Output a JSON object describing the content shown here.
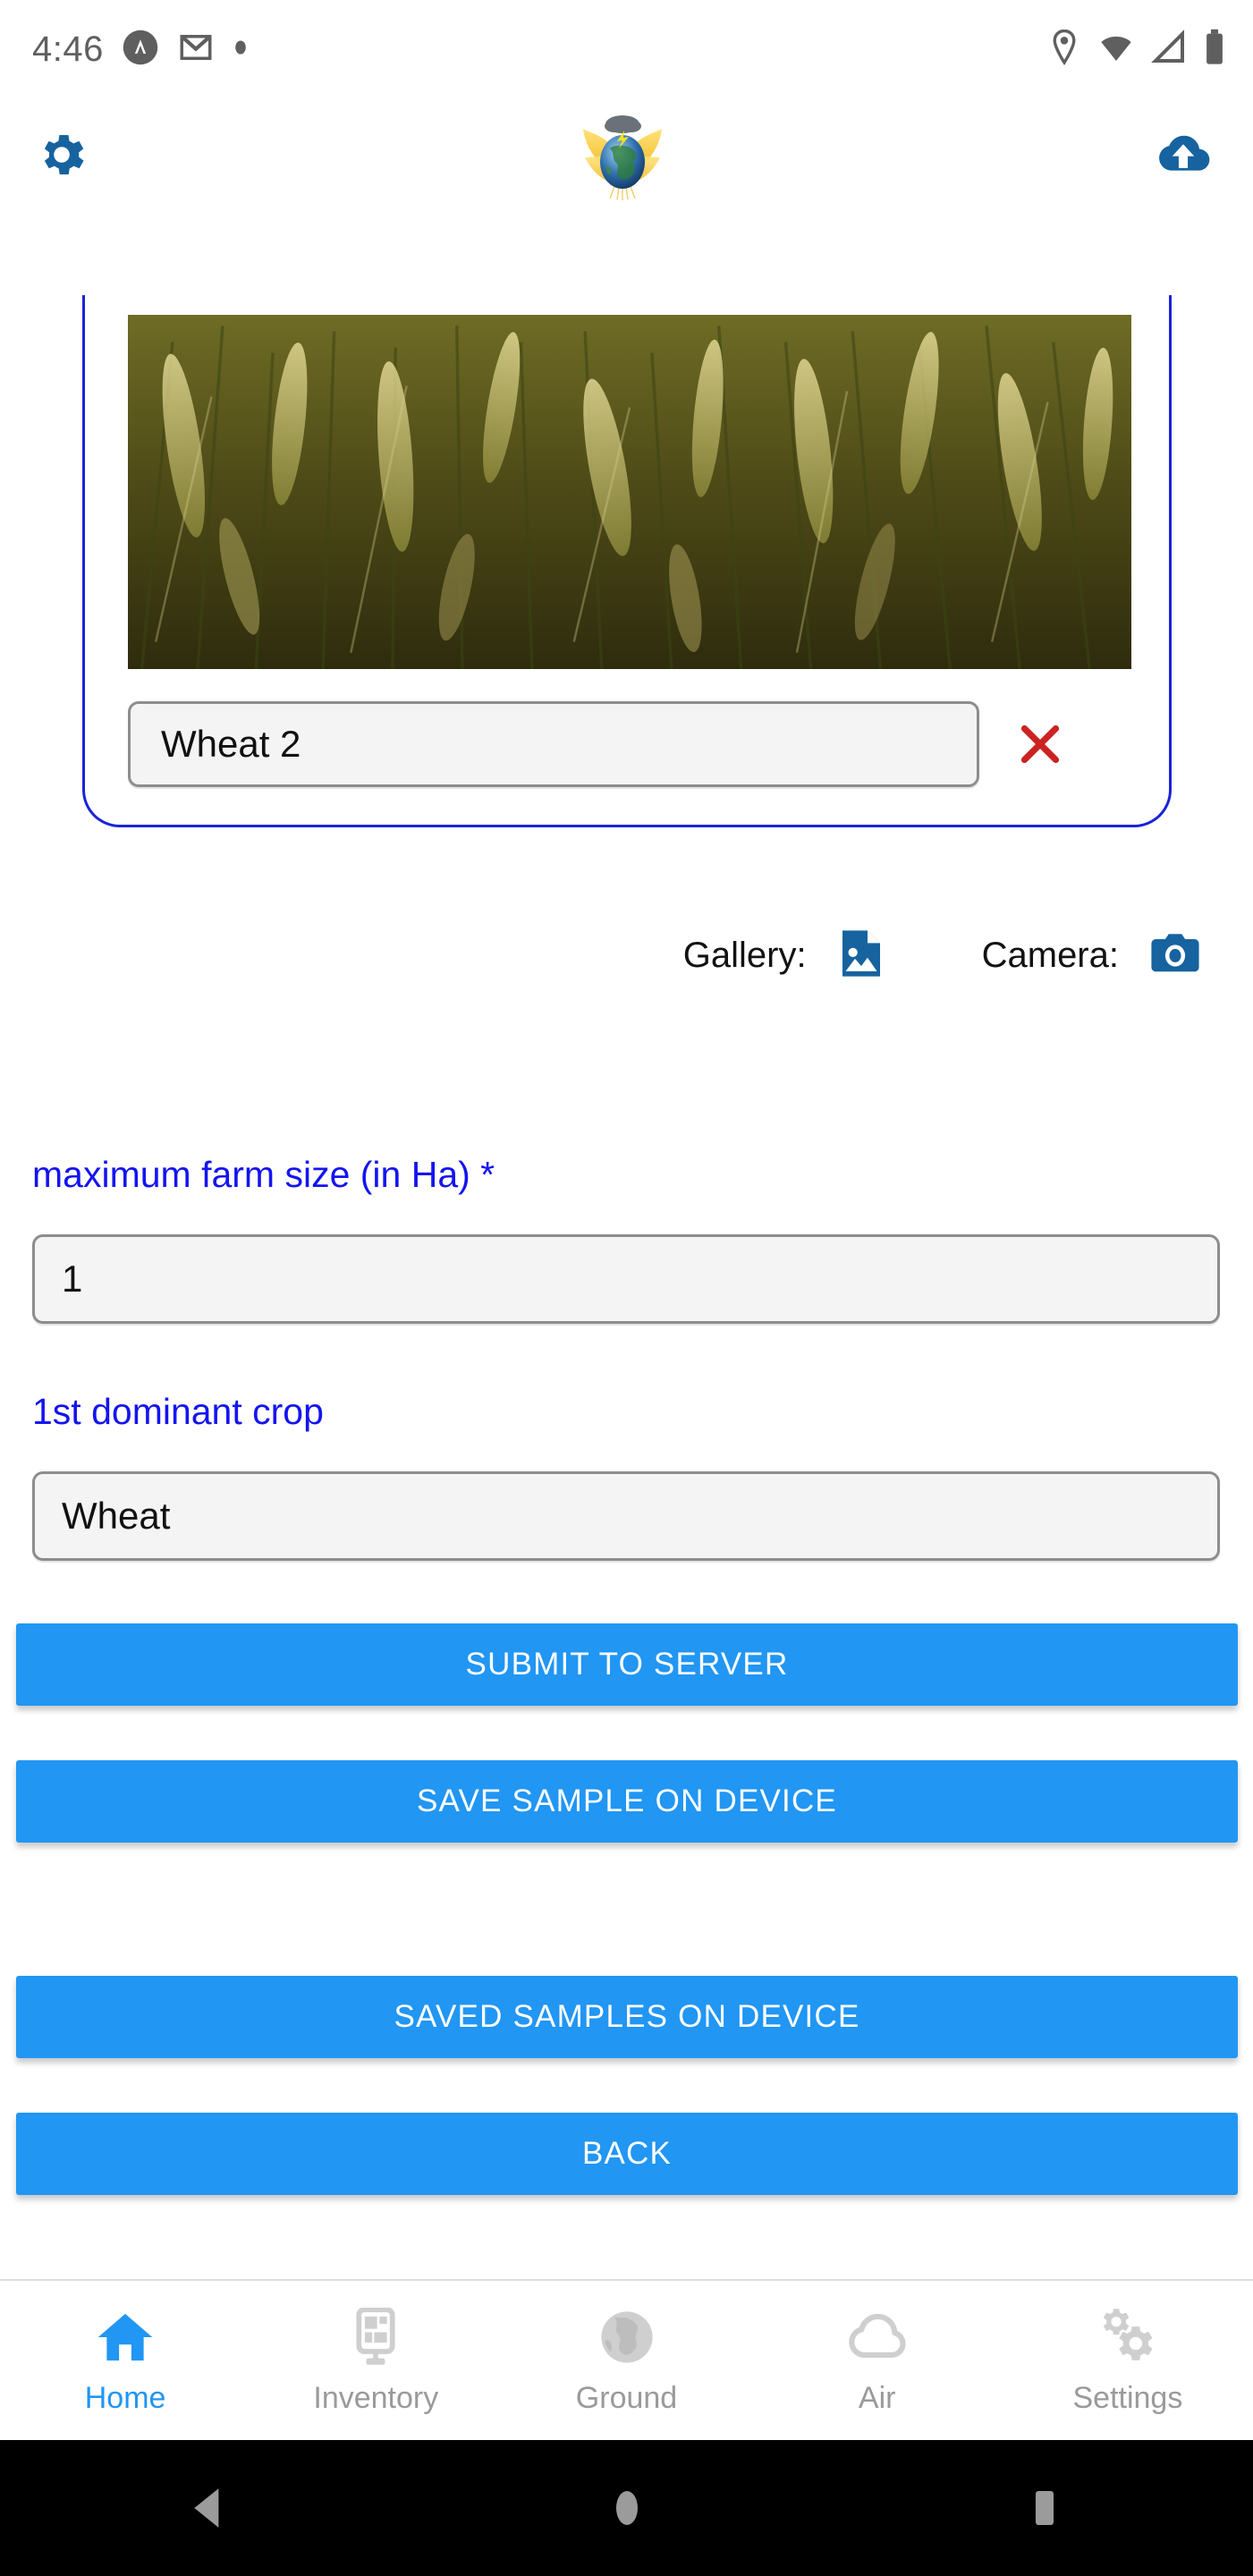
{
  "status_bar": {
    "time": "4:46",
    "left_icons": [
      "assistant-circle-icon",
      "gmail-icon",
      "dot-indicator-icon"
    ],
    "right_icons": [
      "location-icon",
      "wifi-icon",
      "cellular-signal-icon",
      "battery-icon"
    ]
  },
  "app_bar": {
    "settings_icon": "gear-icon",
    "logo": "globe-wheat-logo",
    "upload_icon": "cloud-upload-icon"
  },
  "sample_card": {
    "photo_alt": "wheat-field-photo",
    "name_value": "Wheat 2",
    "name_placeholder": "Wheat 2",
    "delete_icon": "close-x-icon"
  },
  "picker": {
    "gallery_label": "Gallery:",
    "gallery_icon": "image-file-icon",
    "camera_label": "Camera:",
    "camera_icon": "camera-icon"
  },
  "form": {
    "farm_size": {
      "label": "maximum farm size (in Ha) *",
      "value": "1",
      "placeholder": "maximum farm size (in Ha)"
    },
    "dominant_crop": {
      "label": "1st dominant crop",
      "value": "Wheat",
      "placeholder": "1st dominant crop"
    }
  },
  "actions": [
    {
      "label": "SUBMIT TO SERVER",
      "name": "submit-to-server-button"
    },
    {
      "label": "SAVE SAMPLE ON DEVICE",
      "name": "save-sample-on-device-button"
    },
    {
      "label": "SAVED SAMPLES ON DEVICE",
      "name": "saved-samples-on-device-button"
    },
    {
      "label": "BACK",
      "name": "back-button"
    }
  ],
  "bottom_nav": [
    {
      "label": "Home",
      "icon": "home-icon",
      "active": true
    },
    {
      "label": "Inventory",
      "icon": "tablet-device-icon",
      "active": false
    },
    {
      "label": "Ground",
      "icon": "globe-icon",
      "active": false
    },
    {
      "label": "Air",
      "icon": "cloud-icon",
      "active": false
    },
    {
      "label": "Settings",
      "icon": "gears-icon",
      "active": false
    }
  ],
  "system_nav": {
    "back": "triangle-back-icon",
    "home": "circle-home-icon",
    "recents": "square-recents-icon"
  },
  "colors": {
    "primary_blue": "#2196f3",
    "dark_blue": "#16639f",
    "label_blue": "#1414f0",
    "card_border": "#1a23d8",
    "delete_red": "#cc2222",
    "inactive_gray": "#9a9a9a"
  }
}
